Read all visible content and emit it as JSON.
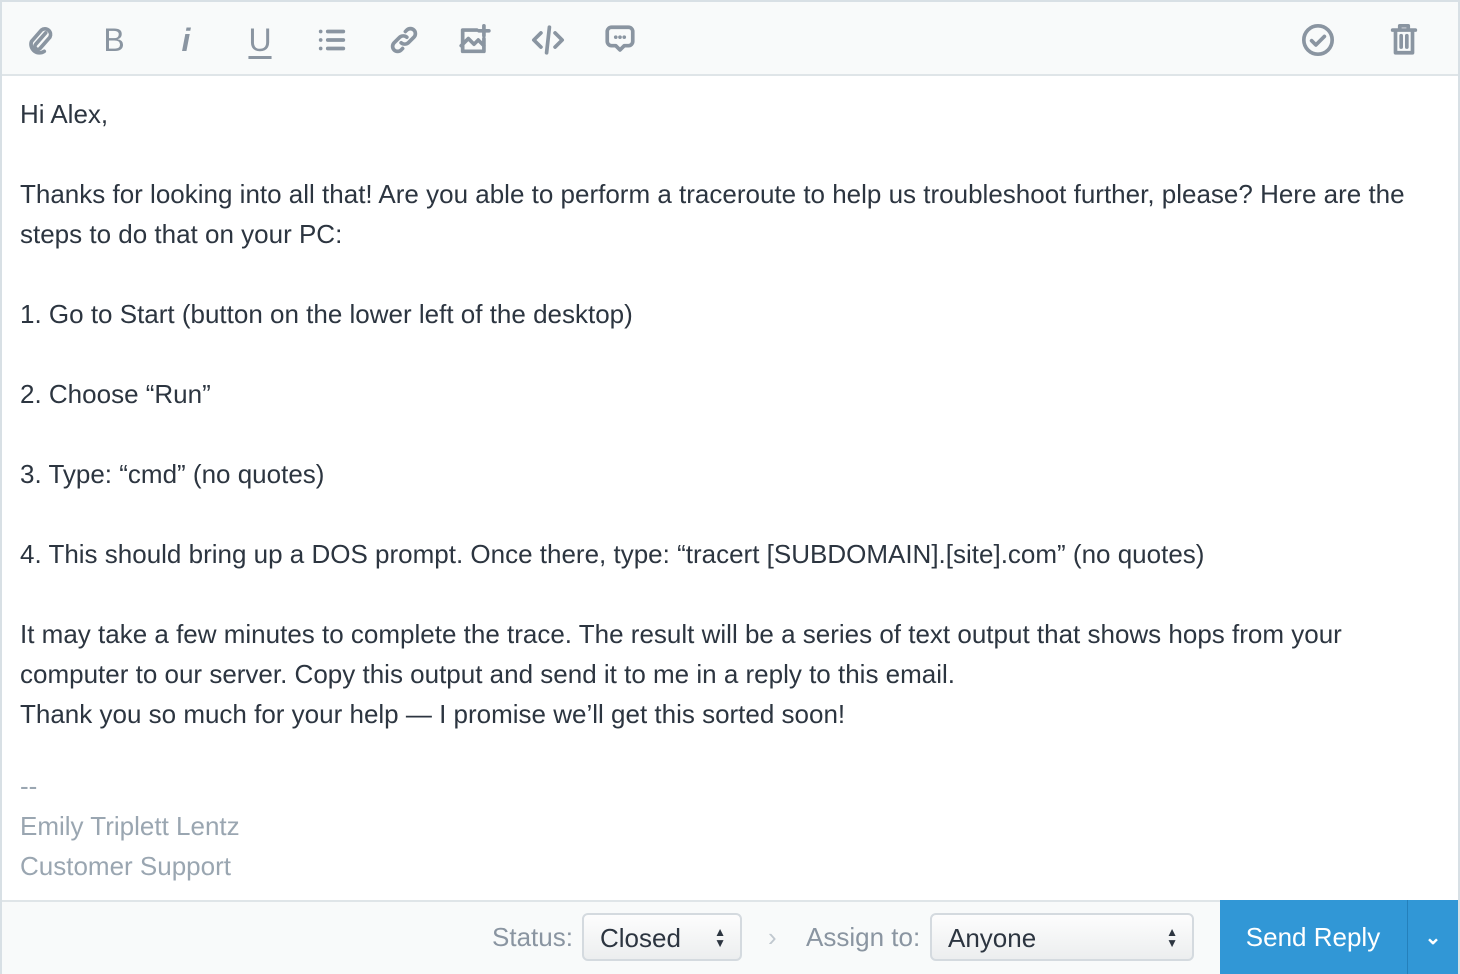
{
  "toolbar": {
    "icons": [
      "paperclip-icon",
      "bold-icon",
      "italic-icon",
      "underline-icon",
      "list-icon",
      "link-icon",
      "image-add-icon",
      "code-icon",
      "comment-icon",
      "check-circle-icon",
      "trash-icon"
    ],
    "bold": "B",
    "italic": "i",
    "underline": "U"
  },
  "message": {
    "greeting": "Hi Alex,",
    "p1": "Thanks for looking into all that! Are you able to perform a traceroute to help us troubleshoot further, please? Here are the steps to do that on your PC:",
    "step1": "1. Go to Start (button on the lower left of the desktop)",
    "step2": "2. Choose “Run”",
    "step3": "3. Type: “cmd” (no quotes)",
    "step4": "4. This should bring up a DOS prompt. Once there, type: “tracert [SUBDOMAIN].[site].com” (no quotes)",
    "p2": "It may take a few minutes to complete the trace. The result will be a series of text output that shows hops from your computer to our server. Copy this output and send it to me in a reply to this email.",
    "p3": "Thank you so much for your help — I promise we’ll get this sorted soon!",
    "sig_sep": "--",
    "sig_name": "Emily Triplett Lentz",
    "sig_title": "Customer Support"
  },
  "footer": {
    "status_label": "Status:",
    "status_value": "Closed",
    "assign_label": "Assign to:",
    "assign_value": "Anyone",
    "send_label": "Send Reply",
    "chevron": "›"
  },
  "colors": {
    "accent": "#3197d6",
    "icon": "#8a95a1",
    "text": "#2c3540"
  }
}
